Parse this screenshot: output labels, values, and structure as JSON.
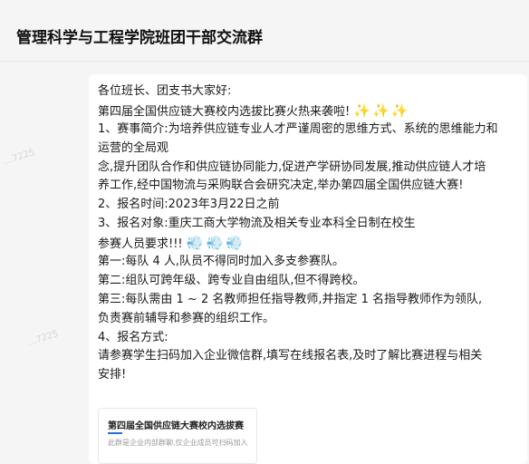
{
  "header": {
    "title": "管理科学与工程学院班团干部交流群"
  },
  "watermarks": [
    "...7225",
    "...7225"
  ],
  "message": {
    "lines": [
      "各位班长、团支书大家好:",
      "第四届全国供应链大赛校内选拔比赛火热来袭啦!",
      "1、赛事简介:为培养供应链专业人才严谨周密的思维方式、系统的思维能力和",
      "运营的全局观",
      "念,提升团队合作和供应链协同能力,促进产学研协同发展,推动供应链人才培",
      "养工作,经中国物流与采购联合会研究决定,举办第四届全国供应链大赛!",
      "2、报名时间:2023年3月22日之前",
      "3、报名对象:重庆工商大学物流及相关专业本科全日制在校生",
      "参赛人员要求!!!",
      "第一:每队 4 人,队员不得同时加入多支参赛队。",
      "第二:组队可跨年级、跨专业自由组队,但不得跨校。",
      "第三:每队需由 1 ~ 2 名教师担任指导教师,并指定 1 名指导教师作为领队,",
      "负责赛前辅导和参赛的组织工作。",
      "4、报名方式:",
      "请参赛学生扫码加入企业微信群,填写在线报名表,及时了解比赛进程与相关",
      "安排!"
    ],
    "sparkles": "✨✨✨",
    "winds": "💨💨💨"
  },
  "card": {
    "title": "第四届全国供应链大赛校内选拔赛",
    "subtitle": "此群是企业内部群聊,仅企业成员可扫码加入"
  }
}
